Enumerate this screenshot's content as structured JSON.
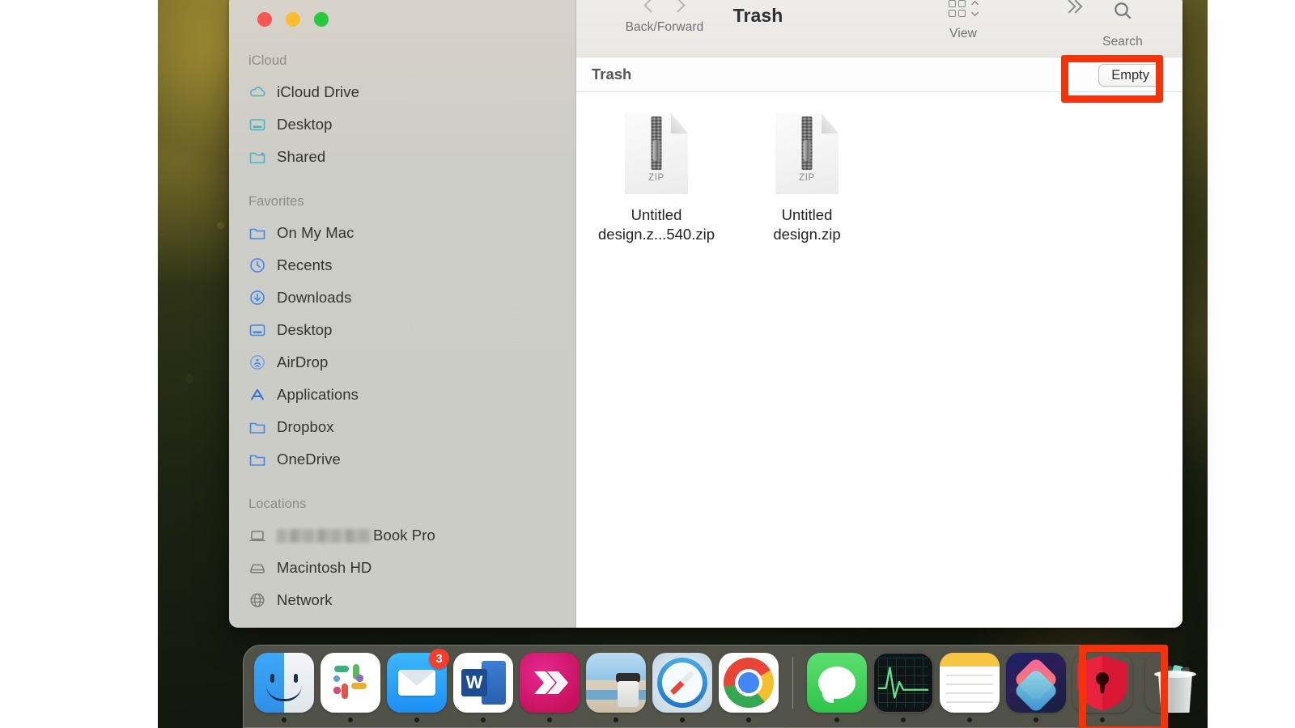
{
  "window": {
    "title": "Trash",
    "traffic_lights": [
      "close",
      "minimize",
      "zoom"
    ]
  },
  "toolbar": {
    "back_forward_label": "Back/Forward",
    "view_label": "View",
    "search_label": "Search",
    "more_icon": "double-chevron-right-icon"
  },
  "pathbar": {
    "title": "Trash",
    "empty_button": "Empty"
  },
  "sidebar": {
    "groups": [
      {
        "title": "iCloud",
        "items": [
          {
            "label": "iCloud Drive",
            "icon": "cloud-icon"
          },
          {
            "label": "Desktop",
            "icon": "desktop-folder-icon"
          },
          {
            "label": "Shared",
            "icon": "shared-folder-icon"
          }
        ]
      },
      {
        "title": "Favorites",
        "items": [
          {
            "label": "On My Mac",
            "icon": "folder-icon"
          },
          {
            "label": "Recents",
            "icon": "clock-icon"
          },
          {
            "label": "Downloads",
            "icon": "download-arrow-icon"
          },
          {
            "label": "Desktop",
            "icon": "desktop-folder-icon"
          },
          {
            "label": "AirDrop",
            "icon": "airdrop-icon"
          },
          {
            "label": "Applications",
            "icon": "applications-icon"
          },
          {
            "label": "Dropbox",
            "icon": "folder-icon"
          },
          {
            "label": "OneDrive",
            "icon": "folder-icon"
          }
        ]
      },
      {
        "title": "Locations",
        "items": [
          {
            "label": "Book Pro",
            "icon": "laptop-icon",
            "redacted_prefix": true
          },
          {
            "label": "Macintosh HD",
            "icon": "harddisk-icon"
          },
          {
            "label": "Network",
            "icon": "globe-icon"
          }
        ]
      }
    ]
  },
  "files": [
    {
      "name": "Untitled design.z...540.zip",
      "kind": "ZIP",
      "icon": "zip-file-icon"
    },
    {
      "name": "Untitled design.zip",
      "kind": "ZIP",
      "icon": "zip-file-icon"
    }
  ],
  "dock": {
    "left_items": [
      {
        "name": "Finder",
        "icon": "finder-icon",
        "running": true
      },
      {
        "name": "Slack",
        "icon": "slack-icon",
        "running": true
      },
      {
        "name": "Mail",
        "icon": "mail-icon",
        "running": true,
        "badge": "3"
      },
      {
        "name": "Microsoft Word",
        "icon": "word-icon",
        "running": true
      },
      {
        "name": "App",
        "icon": "pink-arrows-icon",
        "running": true
      },
      {
        "name": "Photo App",
        "icon": "photo-app-icon",
        "running": false
      },
      {
        "name": "Safari",
        "icon": "safari-icon",
        "running": true
      },
      {
        "name": "Google Chrome",
        "icon": "chrome-icon",
        "running": true
      }
    ],
    "right_items": [
      {
        "name": "Messages",
        "icon": "messages-icon",
        "running": true
      },
      {
        "name": "Activity Monitor",
        "icon": "activity-monitor-icon",
        "running": true
      },
      {
        "name": "Notes",
        "icon": "notes-icon",
        "running": true
      },
      {
        "name": "Shortcuts",
        "icon": "shortcuts-icon",
        "running": true
      },
      {
        "name": "Password Manager",
        "icon": "red-shield-icon",
        "running": true
      },
      {
        "name": "Trash",
        "icon": "trash-full-icon",
        "running": false
      }
    ]
  },
  "annotations": [
    {
      "target": "empty-button",
      "color": "#f5320a"
    },
    {
      "target": "dock-trash",
      "color": "#f5320a"
    }
  ]
}
